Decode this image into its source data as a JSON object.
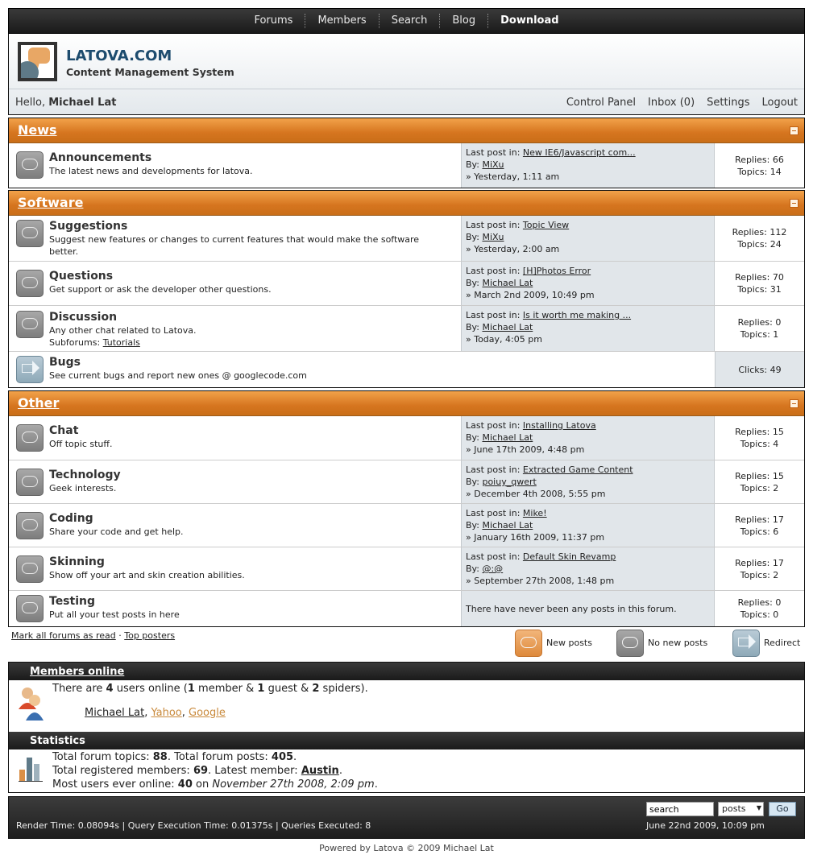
{
  "nav": {
    "items": [
      "Forums",
      "Members",
      "Search",
      "Blog",
      "Download"
    ]
  },
  "header": {
    "title": "LATOVA.COM",
    "subtitle": "Content Management System"
  },
  "userbar": {
    "hello": "Hello,",
    "username": "Michael Lat",
    "links": [
      "Control Panel",
      "Inbox (0)",
      "Settings",
      "Logout"
    ]
  },
  "categories": [
    {
      "title": "News",
      "forums": [
        {
          "name": "Announcements",
          "desc": "The latest news and developments for latova.",
          "lp_label": "Last post in:",
          "lp_topic": "New IE6/Javascript com...",
          "lp_by_label": "By:",
          "lp_by": "MiXu",
          "lp_time": "» Yesterday, 1:11 am",
          "replies": "Replies: 66",
          "topics": "Topics: 14"
        }
      ]
    },
    {
      "title": "Software",
      "forums": [
        {
          "name": "Suggestions",
          "desc": "Suggest new features or changes to current features that would make the software better.",
          "lp_label": "Last post in:",
          "lp_topic": "Topic View",
          "lp_by_label": "By:",
          "lp_by": "MiXu",
          "lp_time": "» Yesterday, 2:00 am",
          "replies": "Replies: 112",
          "topics": "Topics: 24"
        },
        {
          "name": "Questions",
          "desc": "Get support or ask the developer other questions.",
          "lp_label": "Last post in:",
          "lp_topic": "[H]Photos Error",
          "lp_by_label": "By:",
          "lp_by": "Michael Lat",
          "lp_time": "» March 2nd 2009, 10:49 pm",
          "replies": "Replies: 70",
          "topics": "Topics: 31"
        },
        {
          "name": "Discussion",
          "desc": "Any other chat related to Latova.",
          "subforums_label": "Subforums:",
          "subforum": "Tutorials",
          "lp_label": "Last post in:",
          "lp_topic": "Is it worth me making ...",
          "lp_by_label": "By:",
          "lp_by": "Michael Lat",
          "lp_time": "» Today, 4:05 pm",
          "replies": "Replies: 0",
          "topics": "Topics: 1"
        },
        {
          "name": "Bugs",
          "desc": "See current bugs and report new ones @ googlecode.com",
          "clicks": "Clicks: 49"
        }
      ]
    },
    {
      "title": "Other",
      "forums": [
        {
          "name": "Chat",
          "desc": "Off topic stuff.",
          "lp_label": "Last post in:",
          "lp_topic": "Installing Latova",
          "lp_by_label": "By:",
          "lp_by": "Michael Lat",
          "lp_time": "» June 17th 2009, 4:48 pm",
          "replies": "Replies: 15",
          "topics": "Topics: 4"
        },
        {
          "name": "Technology",
          "desc": "Geek interests.",
          "lp_label": "Last post in:",
          "lp_topic": "Extracted Game Content",
          "lp_by_label": "By:",
          "lp_by": "poiuy_qwert",
          "lp_time": "» December 4th 2008, 5:55 pm",
          "replies": "Replies: 15",
          "topics": "Topics: 2"
        },
        {
          "name": "Coding",
          "desc": "Share your code and get help.",
          "lp_label": "Last post in:",
          "lp_topic": "Mike!",
          "lp_by_label": "By:",
          "lp_by": "Michael Lat",
          "lp_time": "» January 16th 2009, 11:37 pm",
          "replies": "Replies: 17",
          "topics": "Topics: 6"
        },
        {
          "name": "Skinning",
          "desc": "Show off your art and skin creation abilities.",
          "lp_label": "Last post in:",
          "lp_topic": "Default Skin Revamp",
          "lp_by_label": "By:",
          "lp_by": "@:@",
          "lp_time": "» September 27th 2008, 1:48 pm",
          "replies": "Replies: 17",
          "topics": "Topics: 2"
        },
        {
          "name": "Testing",
          "desc": "Put all your test posts in here",
          "no_posts": "There have never been any posts in this forum.",
          "replies": "Replies: 0",
          "topics": "Topics: 0"
        }
      ]
    }
  ],
  "legend": {
    "mark_read": "Mark all forums as read",
    "sep": "·",
    "top_posters": "Top posters",
    "new_posts": "New posts",
    "no_new_posts": "No new posts",
    "redirect": "Redirect"
  },
  "online": {
    "title": "Members online",
    "pre": "There are",
    "count": "4",
    "mid1": "users online (",
    "members": "1",
    "mid2": "member &",
    "guests": "1",
    "mid3": "guest &",
    "spiders": "2",
    "mid4": "spiders).",
    "users": [
      "Michael Lat",
      "Yahoo",
      "Google"
    ]
  },
  "statistics": {
    "title": "Statistics",
    "topics_label": "Total forum topics:",
    "topics": "88",
    "posts_label": ". Total forum posts:",
    "posts": "405",
    "reg_label": "Total registered members:",
    "reg": "69",
    "latest_label": ". Latest member:",
    "latest": "Austin",
    "most_label": "Most users ever online:",
    "most": "40",
    "on": "on",
    "most_date": "November 27th 2008, 2:09 pm"
  },
  "footer": {
    "render": "Render Time: 0.08094s | Query Execution Time: 0.01375s | Queries Executed: 8",
    "datetime": "June 22nd 2009, 10:09 pm",
    "search_value": "search",
    "select_value": "posts",
    "go": "Go"
  },
  "powered": "Powered by Latova © 2009 Michael Lat",
  "colors": {
    "accent": "#d6751f",
    "link_orange": "#c98a3c",
    "title_blue": "#1d4c6e"
  }
}
